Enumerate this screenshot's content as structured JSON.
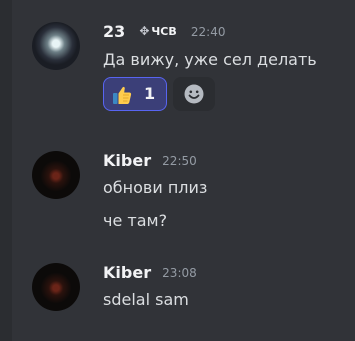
{
  "messages": [
    {
      "username": "23",
      "badge": "ЧСВ",
      "time": "22:40",
      "lines": [
        "Да вижу, уже сел делать"
      ],
      "reaction": {
        "emoji": "thumbs-up",
        "count": "1"
      }
    },
    {
      "username": "Kiber",
      "time": "22:50",
      "lines": [
        "обнови плиз",
        "че там?"
      ]
    },
    {
      "username": "Kiber",
      "time": "23:08",
      "lines": [
        "sdelal sam"
      ]
    }
  ]
}
